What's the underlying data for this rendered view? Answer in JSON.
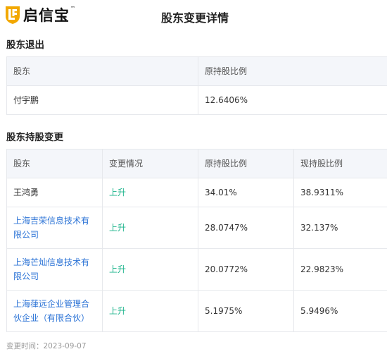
{
  "brand": {
    "name": "启信宝",
    "tm": "™",
    "color": "#f2a800"
  },
  "page": {
    "title": "股东变更详情"
  },
  "exit_section": {
    "title": "股东退出",
    "headers": [
      "股东",
      "原持股比例"
    ],
    "rows": [
      {
        "holder": "付宇鹏",
        "orig": "12.6406%"
      }
    ]
  },
  "change_section": {
    "title": "股东持股变更",
    "headers": [
      "股东",
      "变更情况",
      "原持股比例",
      "现持股比例"
    ],
    "rows": [
      {
        "holder": "王鸿勇",
        "change": "上升",
        "orig": "34.01%",
        "now": "38.9311%"
      },
      {
        "holder": "上海吉荣信息技术有限公司",
        "change": "上升",
        "orig": "28.0747%",
        "now": "32.137%"
      },
      {
        "holder": "上海芒灿信息技术有限公司",
        "change": "上升",
        "orig": "20.0772%",
        "now": "22.9823%"
      },
      {
        "holder": "上海葎远企业管理合伙企业（有限合伙）",
        "change": "上升",
        "orig": "5.1975%",
        "now": "5.9496%"
      }
    ]
  },
  "footer": {
    "text": "变更时间：2023-09-07"
  },
  "colors": {
    "link": "#2b73d6",
    "up": "#19b38a",
    "header_bg": "#f4f6fa"
  }
}
